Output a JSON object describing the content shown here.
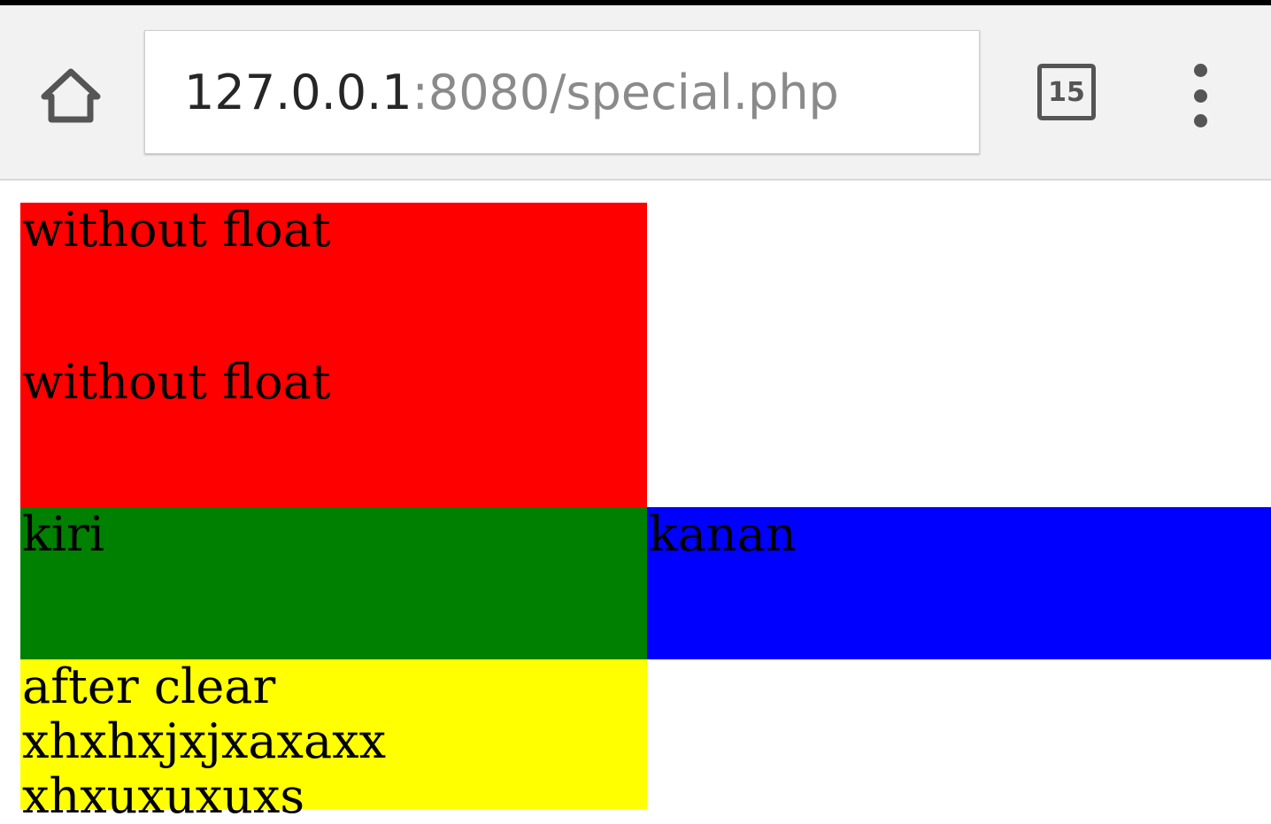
{
  "browser": {
    "url_host": "127.0.0.1",
    "url_rest": ":8080/special.php",
    "tab_count": "15",
    "home_icon": "home-icon",
    "menu_icon": "more-vert-icon"
  },
  "page": {
    "boxes": [
      {
        "text": "without float",
        "color": "#ff0000"
      },
      {
        "text": "without float",
        "color": "#ff0000"
      }
    ],
    "float_left": {
      "text": "kiri",
      "color": "#008000"
    },
    "float_right": {
      "text": "kanan",
      "color": "#0000ff"
    },
    "clear_box": {
      "text": "after clear xhxhxjxjxaxaxx xhxuxuxuxs",
      "color": "#ffff00"
    }
  }
}
